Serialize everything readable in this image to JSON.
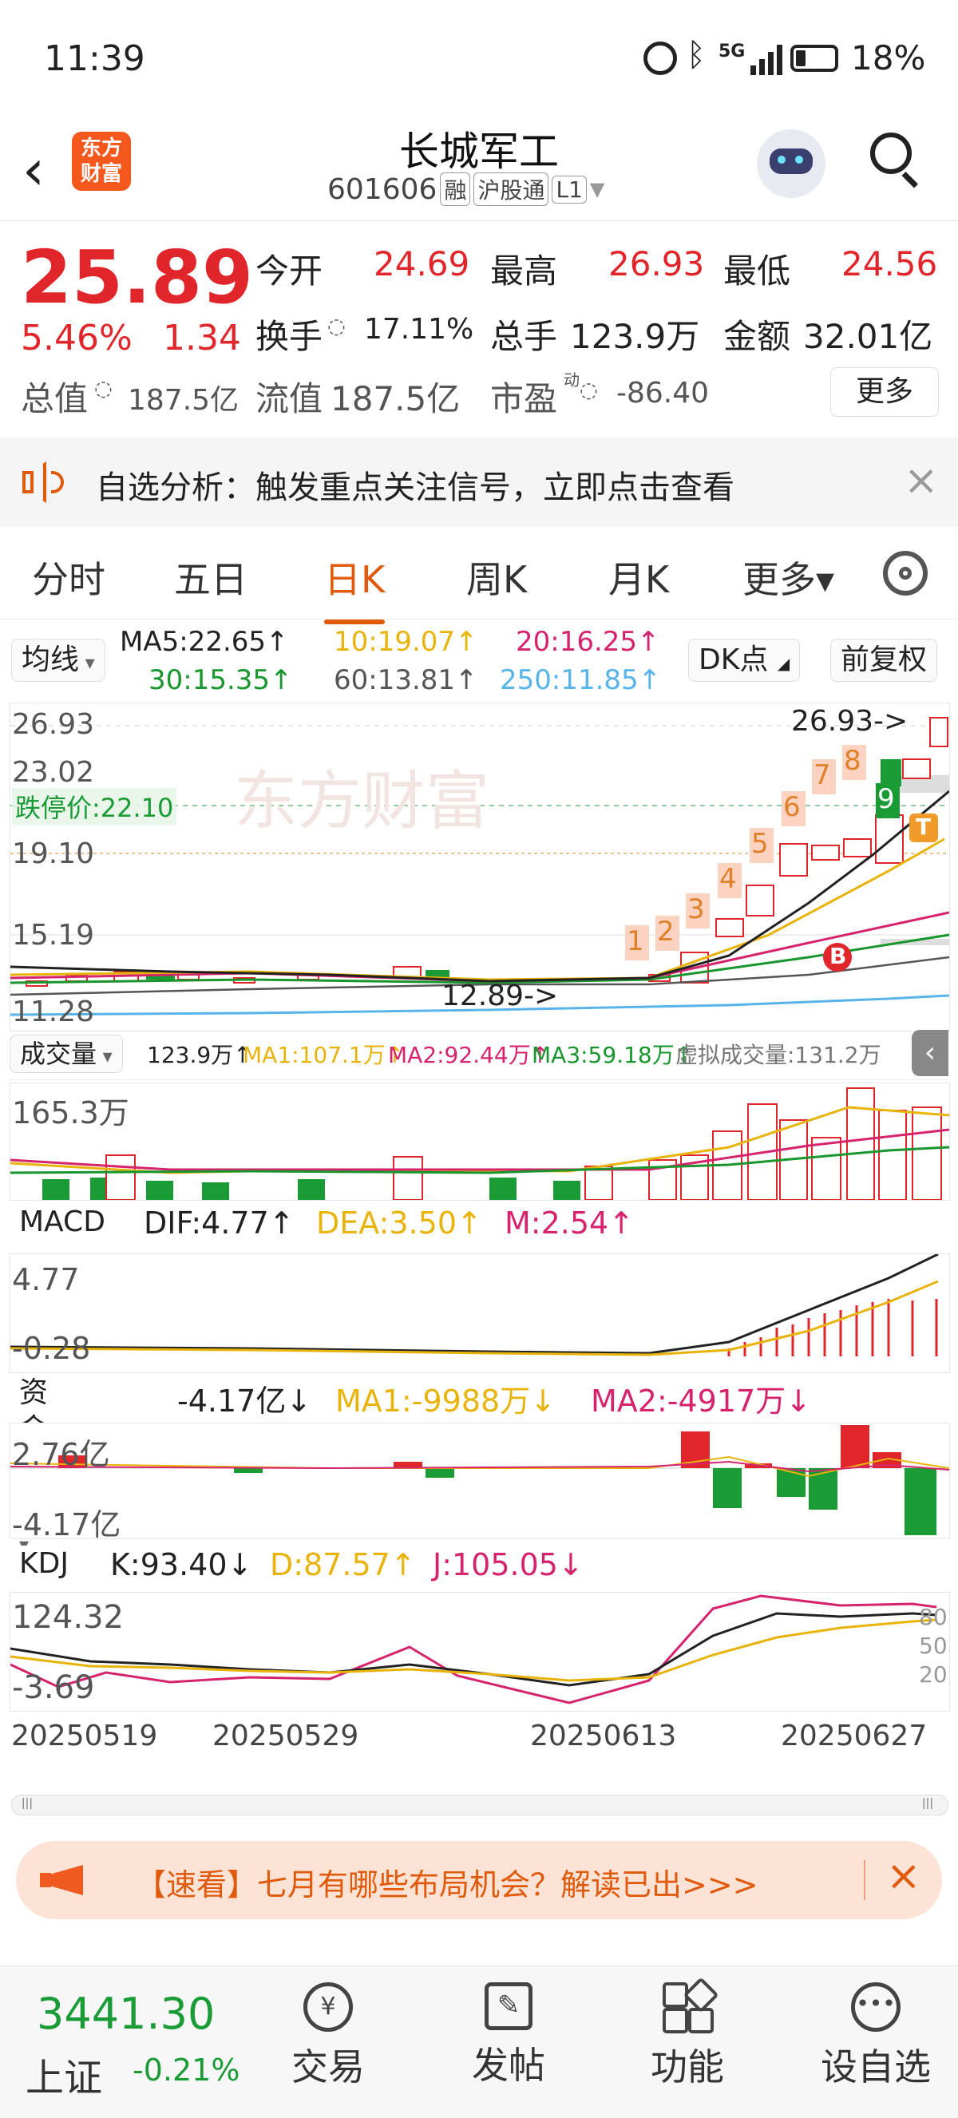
{
  "status_bar": {
    "time": "11:39",
    "network": "5G",
    "battery": "18%"
  },
  "header": {
    "back_icon": "chevron-left-icon",
    "logo_text": "东方\n财富",
    "title": "长城军工",
    "code": "601606",
    "tags": [
      "融",
      "沪股通",
      "L1"
    ],
    "search_icon": "search-icon"
  },
  "quote": {
    "price": "25.89",
    "change_pct": "5.46%",
    "change": "1.34",
    "open_label": "今开",
    "open": "24.69",
    "high_label": "最高",
    "high": "26.93",
    "low_label": "最低",
    "low": "24.56",
    "turnover_label": "换手",
    "turnover": "17.11%",
    "volume_label": "总手",
    "volume": "123.9万",
    "amount_label": "金额",
    "amount": "32.01亿",
    "total_cap_label": "总值",
    "total_cap": "187.5亿",
    "float_cap_label": "流值",
    "float_cap": "187.5亿",
    "pe_label": "市盈",
    "pe_sup": "动",
    "pe": "-86.40",
    "more_button": "更多"
  },
  "notice": {
    "text": "自选分析：触发重点关注信号，立即点击查看"
  },
  "tabs": [
    {
      "label": "分时",
      "active": false
    },
    {
      "label": "五日",
      "active": false
    },
    {
      "label": "日K",
      "active": true
    },
    {
      "label": "周K",
      "active": false
    },
    {
      "label": "月K",
      "active": false
    },
    {
      "label": "更多▾",
      "active": false
    }
  ],
  "ma_bar": {
    "selector": "均线",
    "ma5": "MA5:22.65↑",
    "ma10": "10:19.07↑",
    "ma20": "20:16.25↑",
    "ma30": "30:15.35↑",
    "ma60": "60:13.81↑",
    "ma250": "250:11.85↑",
    "dk_button": "DK点",
    "adjust_button": "前复权",
    "colors": {
      "ma5": "#222222",
      "ma10": "#e8b40c",
      "ma20": "#d6236e",
      "ma30": "#18962d",
      "ma60": "#555555",
      "ma250": "#58b4e8"
    }
  },
  "kline": {
    "y_labels": [
      "26.93",
      "23.02",
      "19.10",
      "15.19",
      "11.28"
    ],
    "limit_down_label": "跌停价:22.10",
    "high_marker": "26.93->",
    "low_marker": "12.89->",
    "watermark": "东方财富",
    "count_labels": [
      "1",
      "2",
      "3",
      "4",
      "5",
      "6",
      "7",
      "8",
      "9"
    ],
    "signal_b": "B",
    "signal_t": "T"
  },
  "volume_bar": {
    "selector": "成交量",
    "vol": "123.9万↑",
    "ma1": "MA1:107.1万↑",
    "ma2": "MA2:92.44万↑",
    "ma3": "MA3:59.18万↑",
    "virtual": "虚拟成交量:131.2万",
    "y_label": "165.3万"
  },
  "macd_bar": {
    "selector": "MACD",
    "dif": "DIF:4.77↑",
    "dea": "DEA:3.50↑",
    "m": "M:2.54↑",
    "y_top": "4.77",
    "y_bottom": "-0.28"
  },
  "fund_bar": {
    "selector": "资金趋势",
    "value": "-4.17亿↓",
    "ma1": "MA1:-9988万↓",
    "ma2": "MA2:-4917万↓",
    "y_top": "2.76亿",
    "y_bottom": "-4.17亿"
  },
  "kdj_bar": {
    "selector": "KDJ",
    "k": "K:93.40↓",
    "d": "D:87.57↑",
    "j": "J:105.05↓",
    "y_top": "124.32",
    "y_bottom": "-3.69",
    "levels": [
      "80",
      "50",
      "20"
    ]
  },
  "dates": [
    "20250519",
    "20250529",
    "20250613",
    "20250627"
  ],
  "banner": {
    "text": "【速看】七月有哪些布局机会？解读已出>>>"
  },
  "bottom_nav": {
    "index_value": "3441.30",
    "index_name": "上证",
    "index_change": "-0.21%",
    "items": [
      "交易",
      "发帖",
      "功能",
      "设自选"
    ]
  }
}
